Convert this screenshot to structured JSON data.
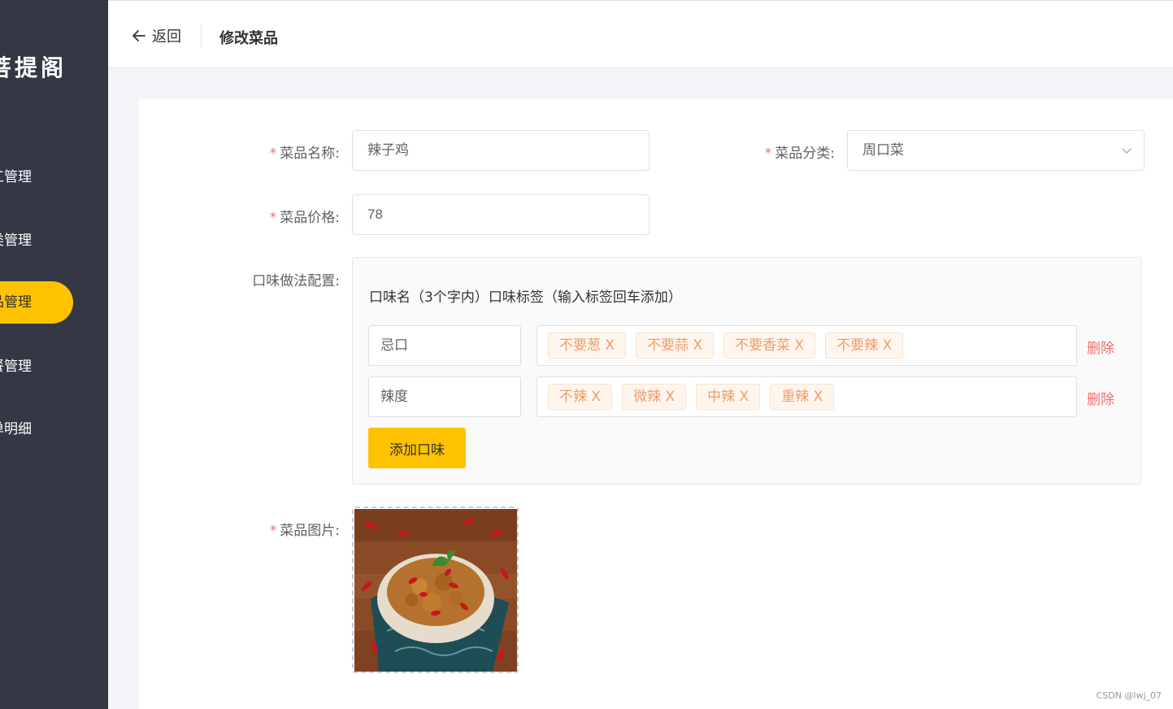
{
  "app": {
    "logo": "菩提阁"
  },
  "sidebar": {
    "items": [
      {
        "label": "工管理",
        "active": false
      },
      {
        "label": "类管理",
        "active": false
      },
      {
        "label": "品管理",
        "active": true
      },
      {
        "label": "餐管理",
        "active": false
      },
      {
        "label": "单明细",
        "active": false
      }
    ]
  },
  "header": {
    "back_label": "返回",
    "title": "修改菜品"
  },
  "form": {
    "name": {
      "label": "菜品名称:",
      "value": "辣子鸡"
    },
    "category": {
      "label": "菜品分类:",
      "value": "周口菜"
    },
    "price": {
      "label": "菜品价格:",
      "value": "78"
    },
    "flavor": {
      "label": "口味做法配置:",
      "header": "口味名（3个字内）口味标签（输入标签回车添加）",
      "rows": [
        {
          "name": "忌口",
          "tags": [
            "不要葱 X",
            "不要蒜 X",
            "不要香菜 X",
            "不要辣 X"
          ],
          "delete_label": "删除"
        },
        {
          "name": "辣度",
          "tags": [
            "不辣 X",
            "微辣 X",
            "中辣 X",
            "重辣 X"
          ],
          "delete_label": "删除"
        }
      ],
      "add_label": "添加口味"
    },
    "image": {
      "label": "菜品图片:"
    },
    "required_mark": "*"
  },
  "watermark": "CSDN @lwj_07",
  "colors": {
    "accent": "#ffc200",
    "sidebar": "#343744",
    "danger": "#f56c6c",
    "tag_text": "#f39b6a"
  }
}
